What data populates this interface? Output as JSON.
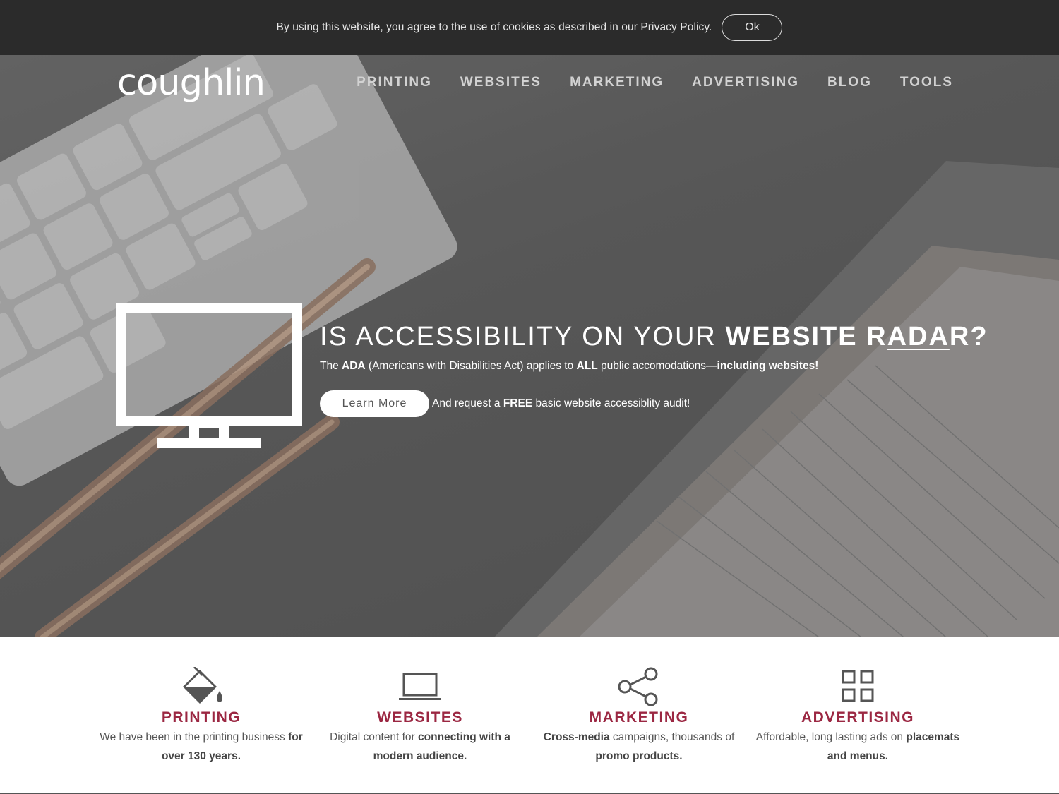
{
  "cookie": {
    "text": "By using this website, you agree to the use of cookies as described in our Privacy Policy.",
    "ok_label": "Ok"
  },
  "header": {
    "logo": "coughlin",
    "nav": [
      "PRINTING",
      "WEBSITES",
      "MARKETING",
      "ADVERTISING",
      "BLOG",
      "TOOLS"
    ]
  },
  "hero": {
    "headline_light": "IS ACCESSIBILITY ON YOUR ",
    "headline_bold_1": "WEBSITE R",
    "headline_underlined": "ADA",
    "headline_bold_2": "R?",
    "sub_1": "The ",
    "sub_ada": "ADA",
    "sub_2": " (Americans with Disabilities Act) applies to ",
    "sub_all": "ALL",
    "sub_3": " public accomodations—",
    "sub_incl": "including websites!",
    "learn_more": "Learn More",
    "cta_1": "And request a ",
    "cta_free": "FREE",
    "cta_2": " basic website accessiblity audit!"
  },
  "services": [
    {
      "icon": "paint-bucket-icon",
      "title": "PRINTING",
      "desc_1": "We have been in the printing business ",
      "desc_bold": "for over 130 years.",
      "desc_2": ""
    },
    {
      "icon": "laptop-icon",
      "title": "WEBSITES",
      "desc_1": "Digital content for ",
      "desc_bold": "connecting with a modern audience.",
      "desc_2": ""
    },
    {
      "icon": "share-icon",
      "title": "MARKETING",
      "desc_bold_first": "Cross-media",
      "desc_1": " campaigns, thousands of ",
      "desc_bold": "promo products.",
      "desc_2": ""
    },
    {
      "icon": "grid-icon",
      "title": "ADVERTISING",
      "desc_1": "Affordable, long lasting ads on ",
      "desc_bold": "placemats and menus.",
      "desc_2": ""
    }
  ],
  "colors": {
    "accent": "#9b2742",
    "cookie_bar": "#2b2b2b",
    "hero_overlay": "#5a5a5a"
  }
}
